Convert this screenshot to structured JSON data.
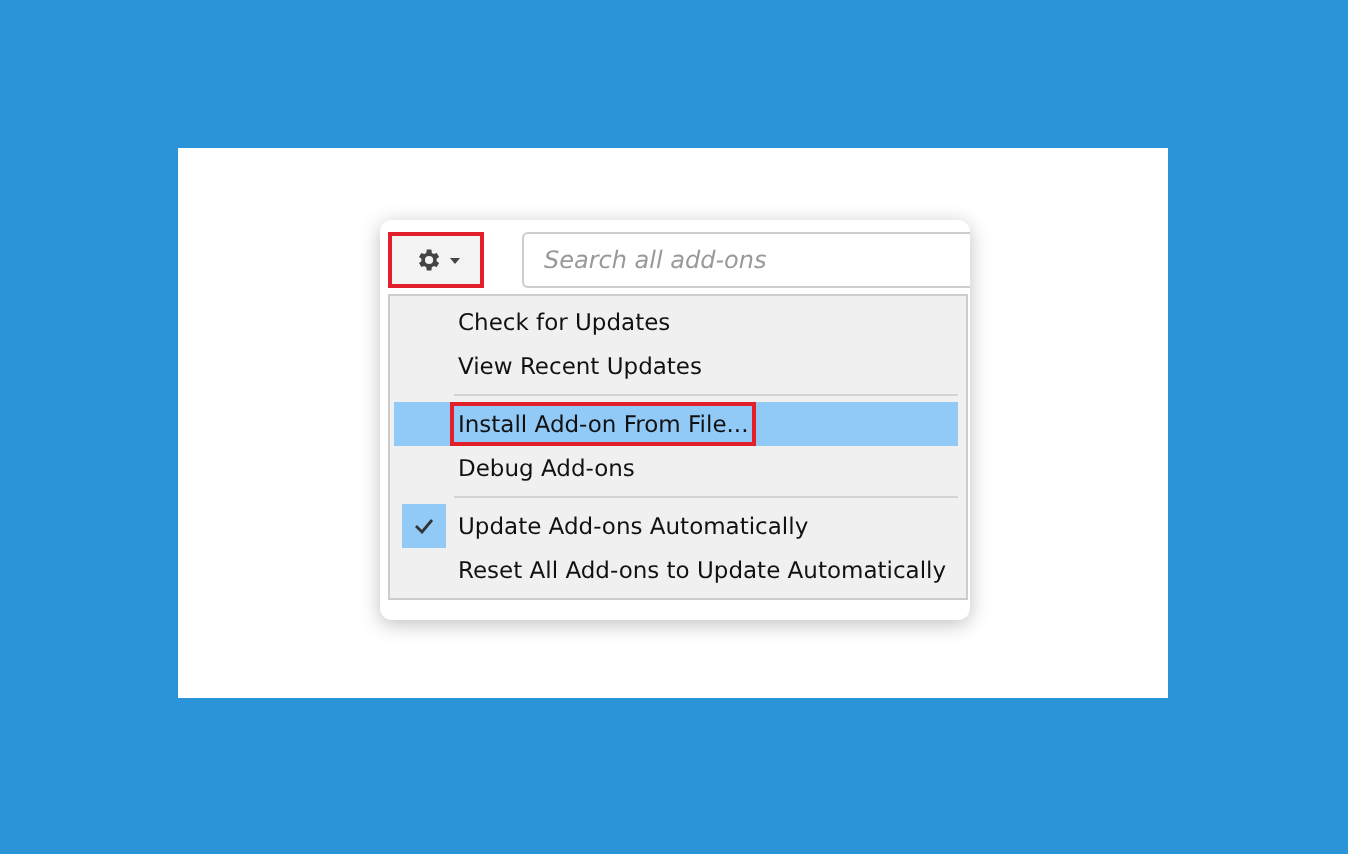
{
  "toolbar": {
    "gear_button": {
      "highlighted": true
    },
    "search": {
      "placeholder": "Search all add-ons"
    }
  },
  "menu": {
    "items": [
      {
        "kind": "item",
        "label": "Check for Updates",
        "selected": false,
        "highlighted": false
      },
      {
        "kind": "item",
        "label": "View Recent Updates",
        "selected": false,
        "highlighted": false
      },
      {
        "kind": "separator"
      },
      {
        "kind": "item",
        "label": "Install Add-on From File...",
        "selected": true,
        "highlighted": true
      },
      {
        "kind": "item",
        "label": "Debug Add-ons",
        "selected": false,
        "highlighted": false
      },
      {
        "kind": "separator"
      },
      {
        "kind": "check",
        "label": "Update Add-ons Automatically",
        "checked": true,
        "selected": false,
        "highlighted": false
      },
      {
        "kind": "item",
        "label": "Reset All Add-ons to Update Automatically",
        "selected": false,
        "highlighted": false
      }
    ]
  }
}
